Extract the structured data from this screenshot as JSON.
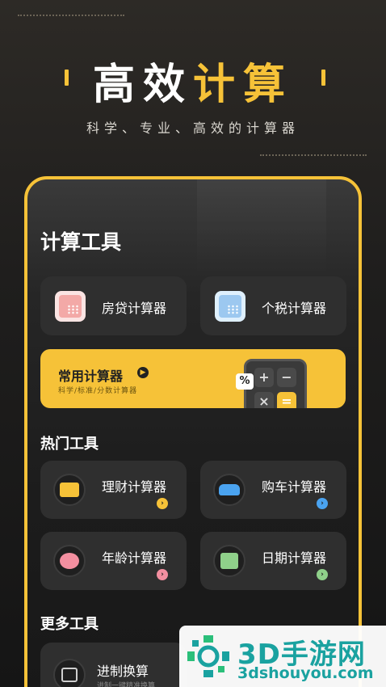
{
  "hero": {
    "title_white": "高效",
    "title_yellow": "计算",
    "subtitle": "科学、专业、高效的计算器"
  },
  "tools": {
    "title": "计算工具",
    "items": [
      {
        "label": "房贷计算器",
        "icon": "mortgage-calculator-icon",
        "color": "#f3a9a7"
      },
      {
        "label": "个税计算器",
        "icon": "tax-calculator-icon",
        "color": "#9cc8f0"
      }
    ]
  },
  "common": {
    "title": "常用计算器",
    "subtitle": "科学/标准/分数计算器",
    "keys": [
      "+",
      "−",
      "×",
      "="
    ],
    "percent": "%"
  },
  "hot": {
    "title": "热门工具",
    "items": [
      {
        "label": "理财计算器",
        "icon": "finance-calculator-icon",
        "accent": "#f6c238"
      },
      {
        "label": "购车计算器",
        "icon": "car-icon",
        "accent": "#4aa3f0"
      },
      {
        "label": "年龄计算器",
        "icon": "piggy-bank-icon",
        "accent": "#f38fa0"
      },
      {
        "label": "日期计算器",
        "icon": "calendar-icon",
        "accent": "#8fd08a"
      }
    ]
  },
  "more": {
    "title": "更多工具",
    "items": [
      {
        "label": "进制换算",
        "sub": "进制一键精准换算",
        "icon": "base-convert-icon"
      }
    ]
  },
  "watermark": {
    "name": "3D手游网",
    "url": "3dshouyou.com"
  },
  "colors": {
    "accent": "#f6c238",
    "tile": "#2f2f2f"
  }
}
